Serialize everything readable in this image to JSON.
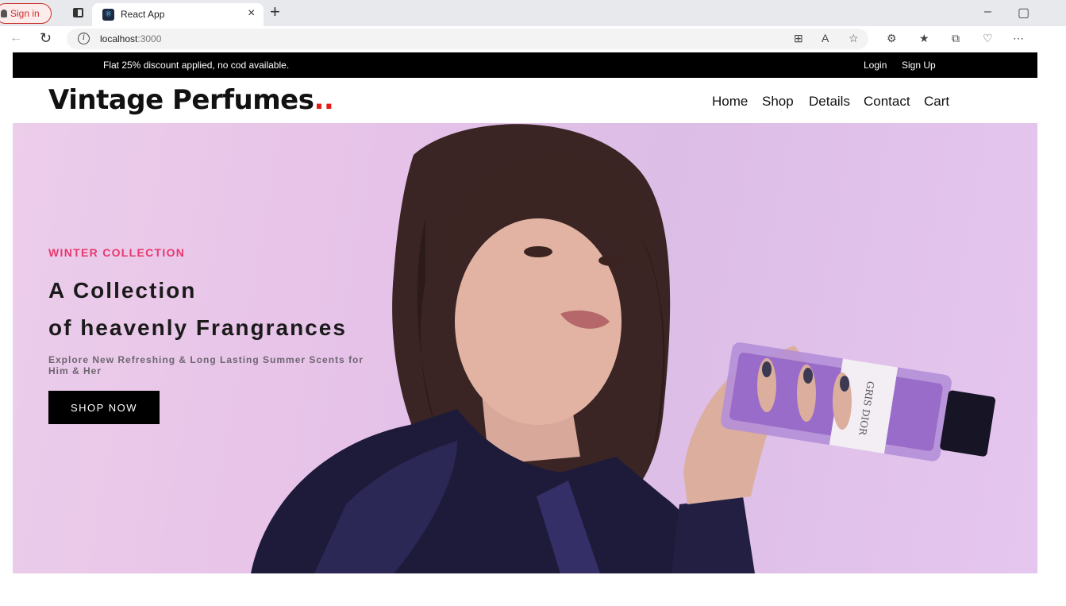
{
  "browser": {
    "signin_label": "Sign in",
    "tab_title": "React App",
    "url_host": "localhost",
    "url_port": ":3000"
  },
  "promo": {
    "text": "Flat 25% discount applied, no cod available.",
    "login": "Login",
    "signup": "Sign Up"
  },
  "header": {
    "logo_text": "Vintage Perfumes",
    "logo_dots": "..",
    "nav": [
      "Home",
      "Shop",
      "Details",
      "Contact",
      "Cart"
    ]
  },
  "hero": {
    "subtitle": "WINTER COLLECTION",
    "headline_line1": "A Collection",
    "headline_line2": "of heavenly Frangrances",
    "description": "Explore New Refreshing & Long Lasting Summer Scents for Him & Her",
    "button": "SHOP NOW",
    "bottle_label": "GRIS DIOR"
  },
  "colors": {
    "accent_pink": "#e8386d",
    "logo_dots_red": "#e41b17",
    "promo_bar": "#000000",
    "hero_bg": "#e6c2e8"
  }
}
